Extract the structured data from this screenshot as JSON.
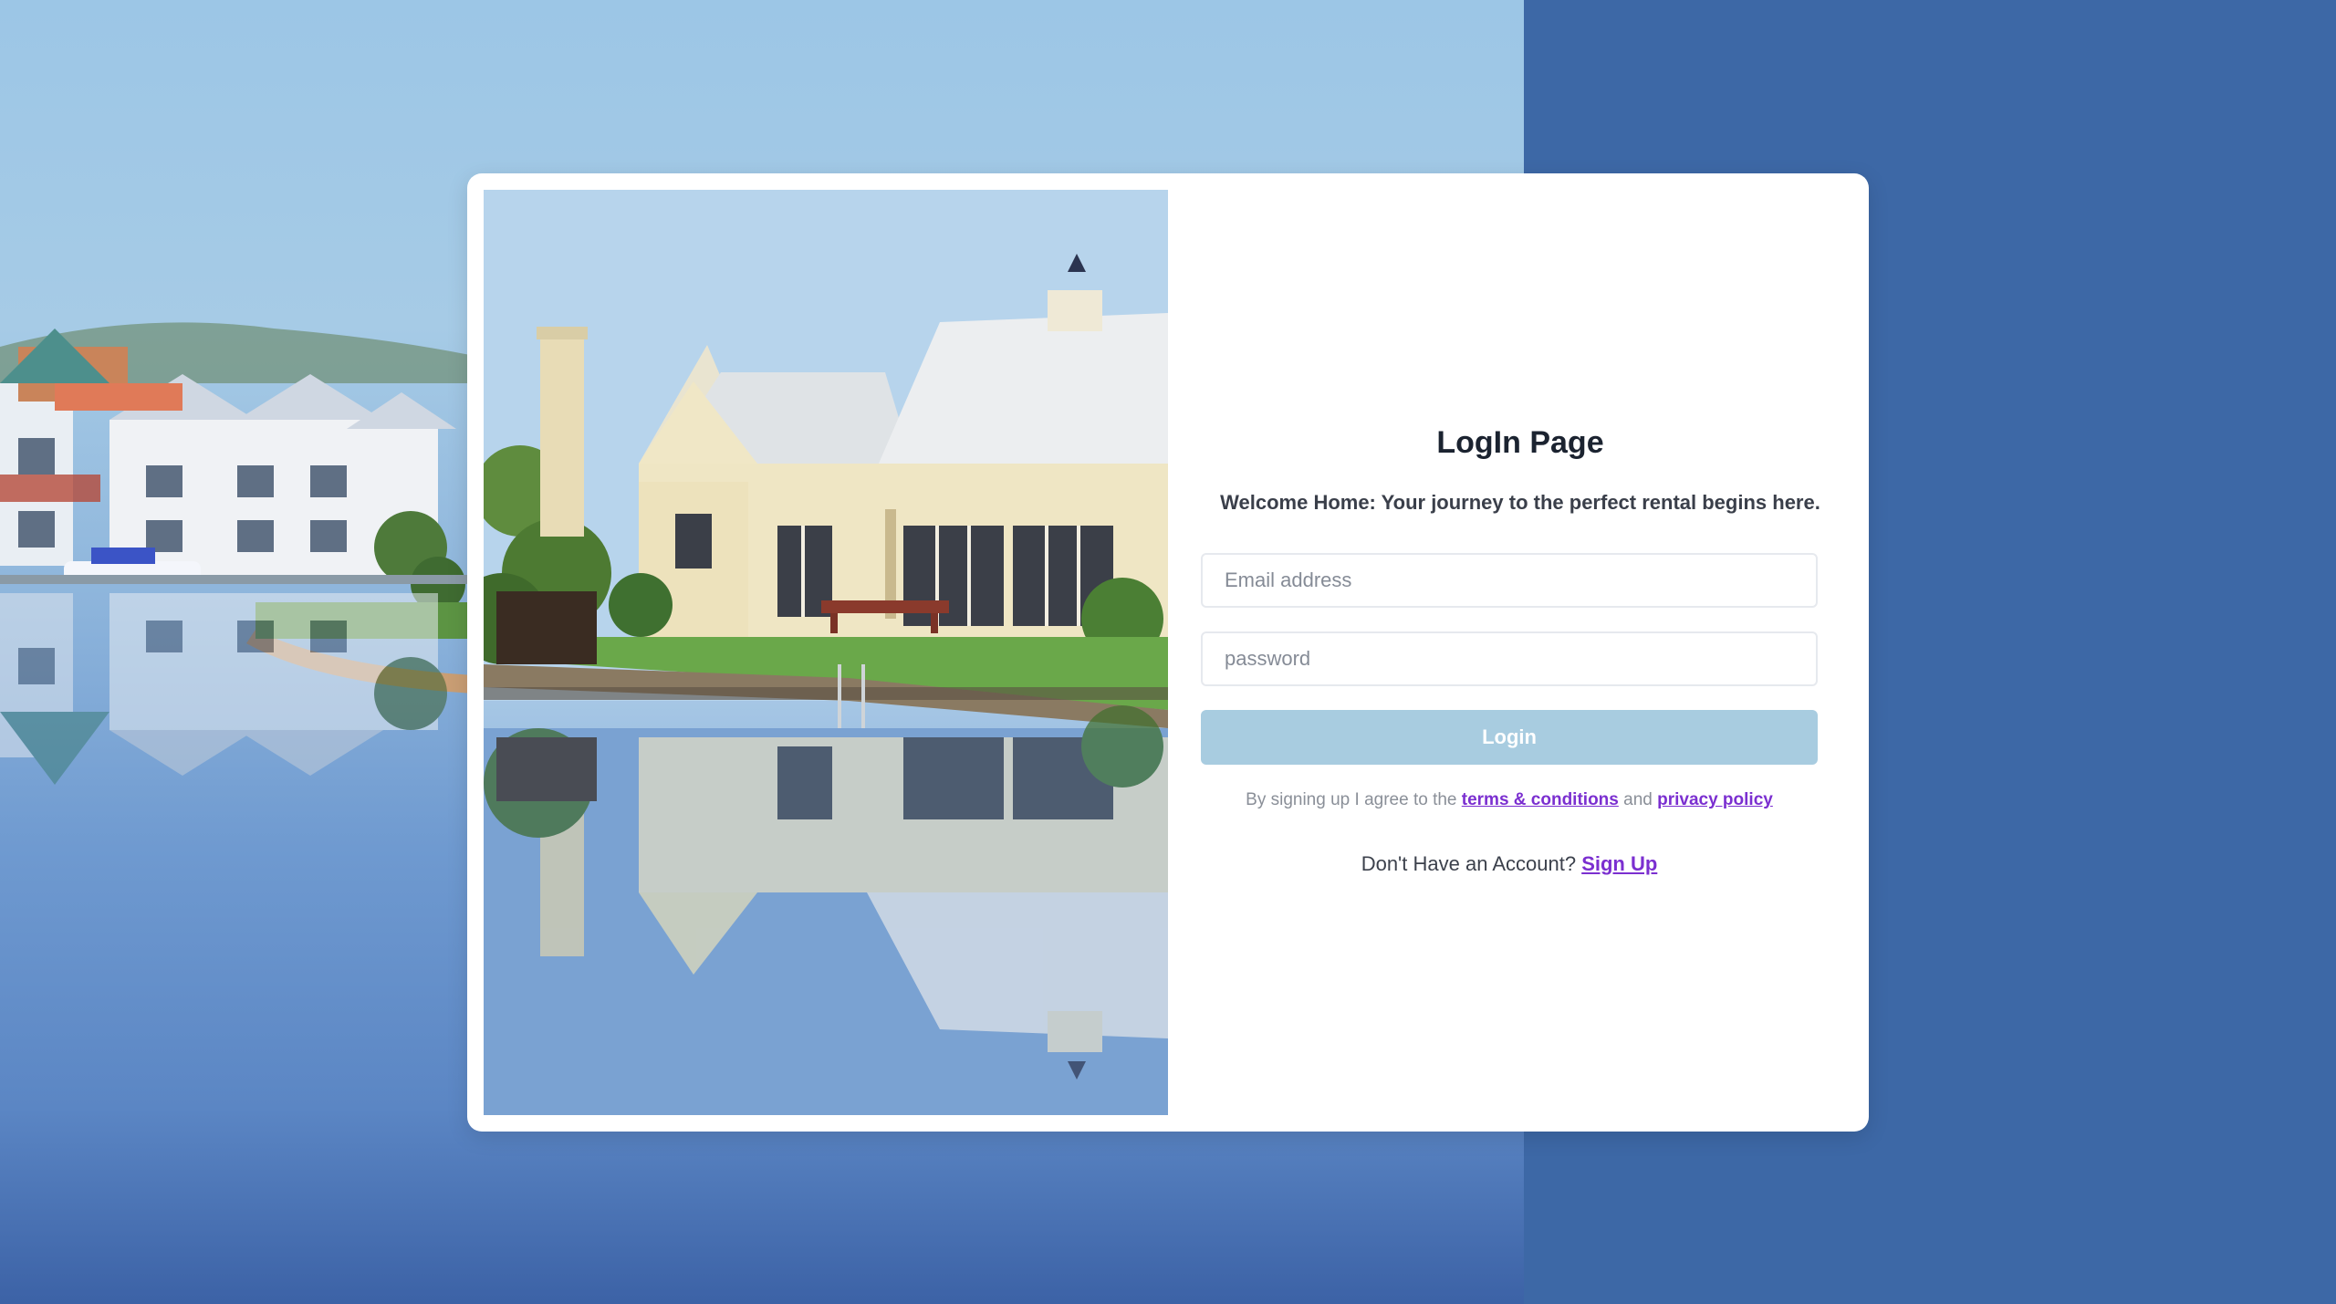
{
  "login": {
    "title": "LogIn Page",
    "subtitle": "Welcome Home: Your journey to the perfect rental begins here.",
    "email_placeholder": "Email address",
    "password_placeholder": "password",
    "login_button": "Login",
    "terms_prefix": "By signing up I agree to the",
    "terms_link": "terms & conditions",
    "terms_and": "and",
    "privacy_link": "privacy policy",
    "signup_prompt": "Don't Have an Account?",
    "signup_link": "Sign Up"
  },
  "colors": {
    "page_background": "#3d68a6",
    "button_background": "#a8cce0",
    "link": "#7b2fd0",
    "title": "#1b2330"
  }
}
